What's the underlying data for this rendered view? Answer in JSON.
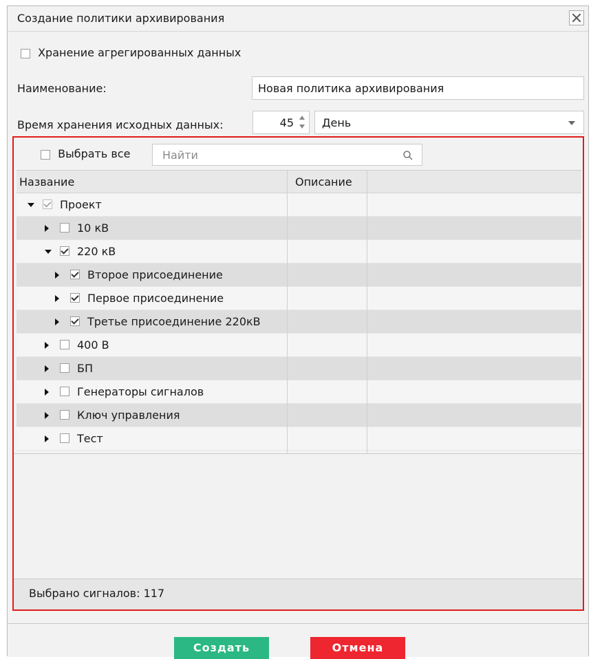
{
  "dialog": {
    "title": "Создание политики архивирования"
  },
  "form": {
    "aggregated_label": "Хранение агрегированных данных",
    "aggregated_checked": false,
    "name_label": "Наименование:",
    "name_value": "Новая политика архивирования",
    "retention_label": "Время хранения исходных данных:",
    "retention_value": "45",
    "retention_unit": "День"
  },
  "panel": {
    "select_all_label": "Выбрать все",
    "search_placeholder": "Найти",
    "columns": [
      "Название",
      "Описание"
    ],
    "rows": [
      {
        "label": "Проект",
        "level": 0,
        "expanded": true,
        "checked": true,
        "dim": true
      },
      {
        "label": "10 кВ",
        "level": 1,
        "expanded": false,
        "checked": false
      },
      {
        "label": "220 кВ",
        "level": 1,
        "expanded": true,
        "checked": true
      },
      {
        "label": "Второе присоединение",
        "level": 2,
        "expanded": false,
        "checked": true
      },
      {
        "label": "Первое присоединение",
        "level": 2,
        "expanded": false,
        "checked": true
      },
      {
        "label": "Третье присоединение 220кВ",
        "level": 2,
        "expanded": false,
        "checked": true
      },
      {
        "label": "400 В",
        "level": 1,
        "expanded": false,
        "checked": false
      },
      {
        "label": "БП",
        "level": 1,
        "expanded": false,
        "checked": false
      },
      {
        "label": "Генераторы сигналов",
        "level": 1,
        "expanded": false,
        "checked": false
      },
      {
        "label": "Ключ управления",
        "level": 1,
        "expanded": false,
        "checked": false
      },
      {
        "label": "Тест",
        "level": 1,
        "expanded": false,
        "checked": false
      }
    ],
    "status": "Выбрано сигналов: 117"
  },
  "buttons": {
    "create": "Создать",
    "cancel": "Отмена"
  },
  "colors": {
    "create": "#2bb884",
    "cancel": "#ee2630",
    "highlight_border": "#e21a1a"
  }
}
